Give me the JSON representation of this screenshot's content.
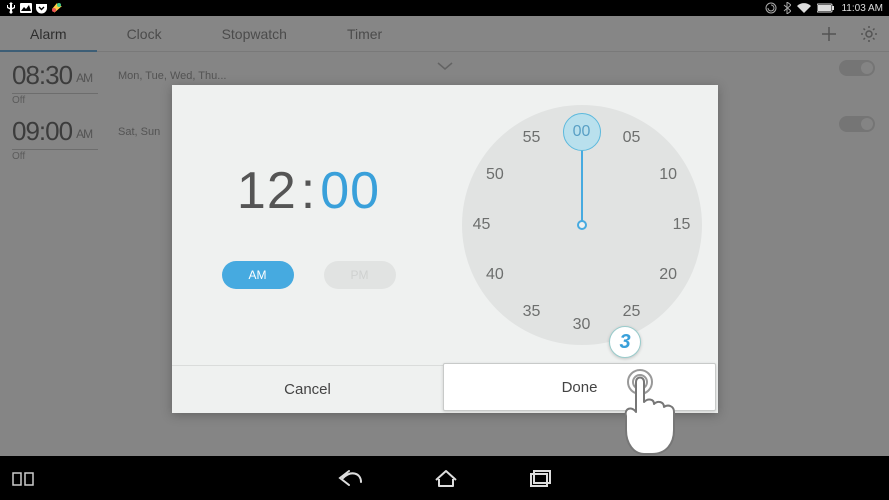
{
  "status": {
    "time": "11:03 AM"
  },
  "tabs": {
    "items": [
      "Alarm",
      "Clock",
      "Stopwatch",
      "Timer"
    ],
    "active_index": 0
  },
  "alarms": [
    {
      "time": "08:30",
      "ampm": "AM",
      "days": "Mon, Tue, Wed, Thu...",
      "state": "Off",
      "enabled": false,
      "expandable": true
    },
    {
      "time": "09:00",
      "ampm": "AM",
      "days": "Sat, Sun",
      "state": "Off",
      "enabled": false,
      "expandable": false
    }
  ],
  "picker": {
    "hour": "12",
    "minute": "00",
    "ampm_selected": "AM",
    "ampm_labels": {
      "am": "AM",
      "pm": "PM"
    },
    "ticks": [
      "00",
      "05",
      "10",
      "15",
      "20",
      "25",
      "30",
      "35",
      "40",
      "45",
      "50",
      "55"
    ],
    "selected_tick": "00",
    "cancel_label": "Cancel",
    "done_label": "Done"
  },
  "step_badge": "3",
  "icons": {
    "add": "add-icon",
    "settings": "gear-icon",
    "usb": "usb-icon",
    "image": "image-icon",
    "pocket": "pocket-icon",
    "drive": "drive-icon",
    "sync": "sync-icon",
    "bt": "bluetooth-icon",
    "wifi": "wifi-icon",
    "battery": "battery-icon",
    "recent": "recent-apps-icon",
    "back": "back-icon",
    "home": "home-icon",
    "overview": "overview-icon",
    "chevron": "chevron-down-icon"
  }
}
